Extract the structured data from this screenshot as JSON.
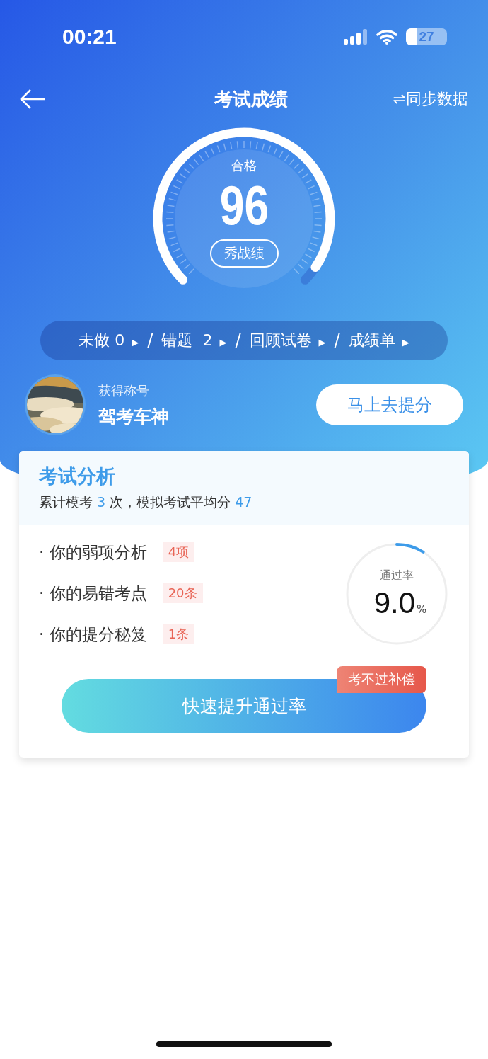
{
  "status_bar": {
    "time": "00:21",
    "battery": "27"
  },
  "nav": {
    "title": "考试成绩",
    "sync": "⇌同步数据"
  },
  "score": {
    "status": "合格",
    "value": "96",
    "share": "秀战绩"
  },
  "links": [
    {
      "label": "未做 0"
    },
    {
      "label": "错题  2"
    },
    {
      "label": "回顾试卷"
    },
    {
      "label": "成绩单"
    }
  ],
  "link_marker": "▶",
  "link_separator": "/",
  "profile": {
    "caption": "获得称号",
    "title": "驾考车神",
    "button": "马上去提分"
  },
  "analysis": {
    "title": "考试分析",
    "summary": [
      {
        "text": "累计模考 ",
        "highlight": false
      },
      {
        "text": "3",
        "highlight": true
      },
      {
        "text": " 次，模拟考试平均分 ",
        "highlight": false
      },
      {
        "text": "47",
        "highlight": true
      }
    ],
    "items": [
      {
        "label": "· 你的弱项分析",
        "tag": "4项"
      },
      {
        "label": "· 你的易错考点",
        "tag": "20条"
      },
      {
        "label": "· 你的提分秘笈",
        "tag": "1条"
      }
    ],
    "pass_rate": {
      "label": "通过率",
      "value": "9.0",
      "unit": "%"
    },
    "button": "快速提升通过率",
    "badge": "考不过补偿"
  }
}
